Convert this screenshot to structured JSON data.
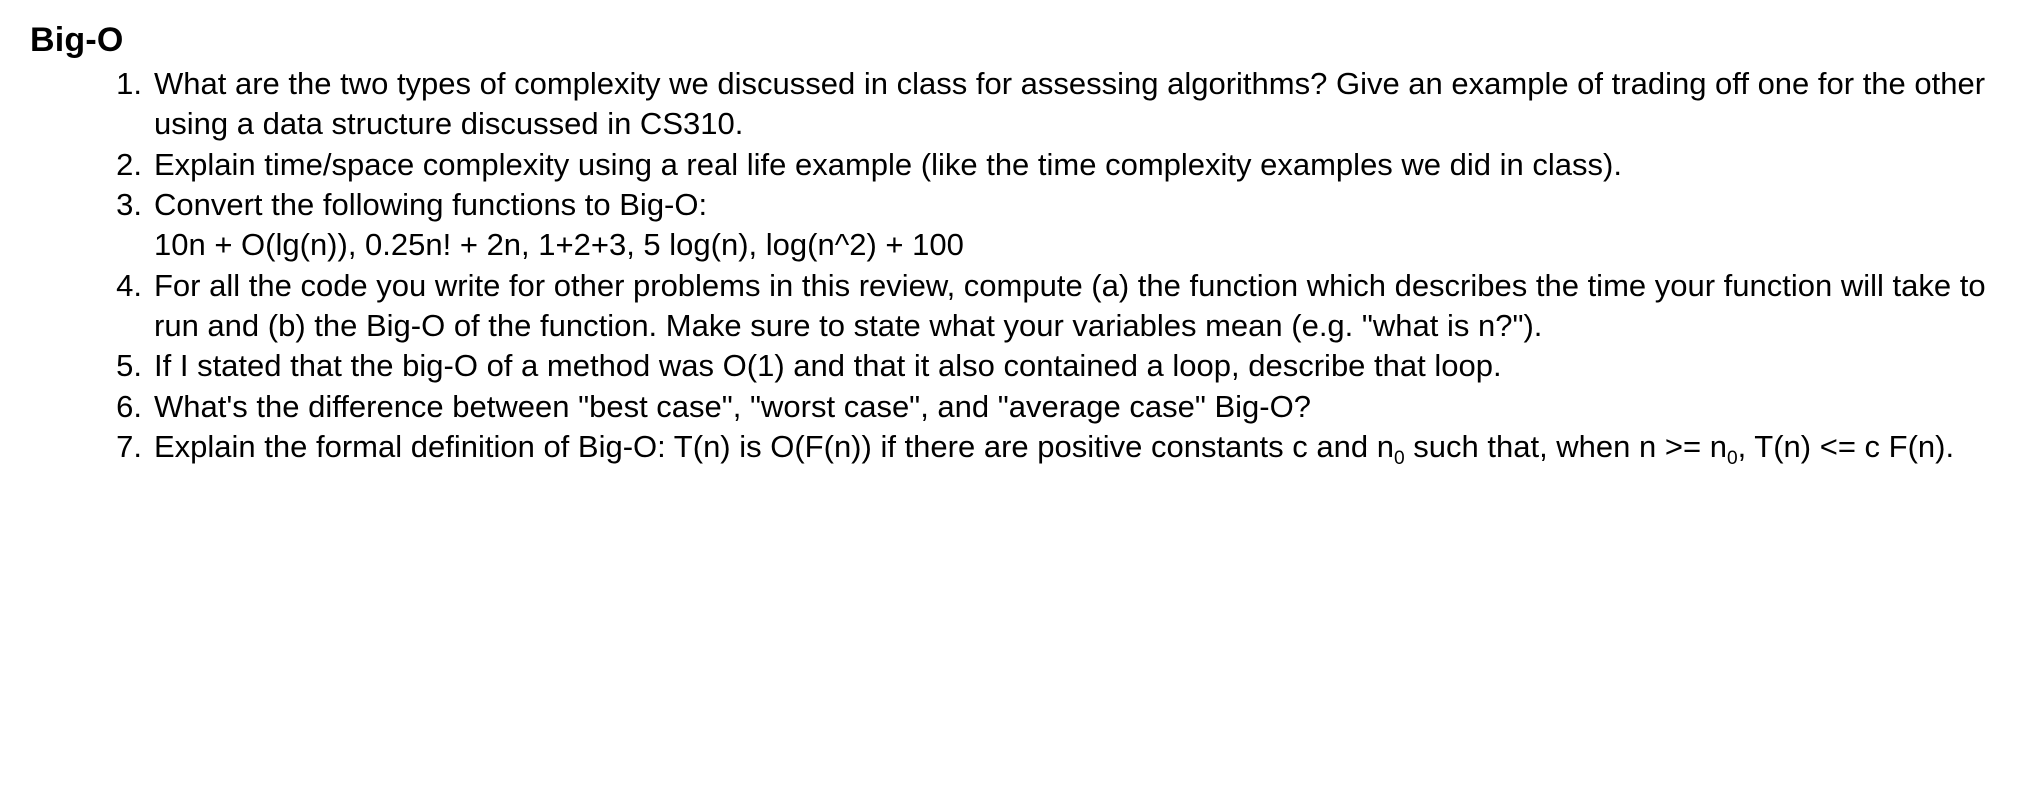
{
  "heading": "Big-O",
  "items": [
    {
      "num": "1.",
      "lines": [
        "What are the two types of complexity we discussed in class for assessing algorithms? Give an example of trading off one for the other using a data structure discussed in CS310."
      ]
    },
    {
      "num": "2.",
      "lines": [
        "Explain time/space complexity using a real life example (like the time complexity examples we did in class)."
      ]
    },
    {
      "num": "3.",
      "lines": [
        "Convert the following functions to Big-O:",
        "10n + O(lg(n)), 0.25n! + 2n, 1+2+3, 5 log(n), log(n^2) + 100"
      ]
    },
    {
      "num": "4.",
      "lines": [
        "For all the code you write for other problems in this review, compute (a) the function which describes the time your function will take to run and (b) the Big-O of the function. Make sure to state what your variables mean (e.g. \"what is n?\")."
      ]
    },
    {
      "num": "5.",
      "lines": [
        "If I stated that the big-O of a method was O(1) and that it also contained a loop, describe that loop."
      ]
    },
    {
      "num": "6.",
      "lines": [
        "What's the difference between \"best case\", \"worst case\", and \"average case\" Big-O?"
      ]
    },
    {
      "num": "7.",
      "lines": [
        "Explain the formal definition of Big-O: T(n) is O(F(n)) if there are positive constants c and n₀ such that, when n >= n₀, T(n) <= c F(n)."
      ]
    }
  ]
}
